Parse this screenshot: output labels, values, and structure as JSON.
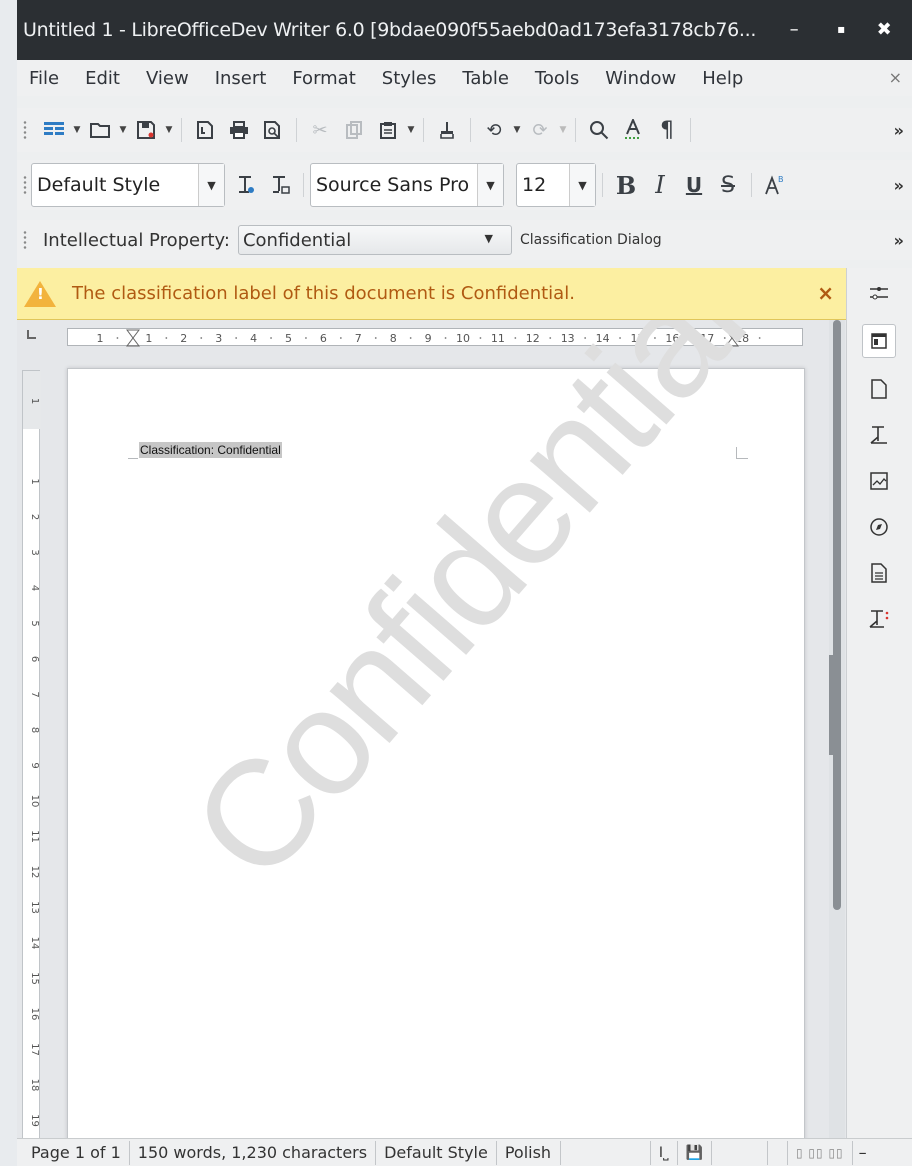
{
  "window": {
    "title": "Untitled 1 - LibreOfficeDev Writer 6.0 [9bdae090f55aebd0ad173efa3178cb76...",
    "minimize_glyph": "–",
    "maximize_glyph": "▪",
    "close_glyph": "✖"
  },
  "menu": {
    "items": [
      "File",
      "Edit",
      "View",
      "Insert",
      "Format",
      "Styles",
      "Table",
      "Tools",
      "Window",
      "Help"
    ],
    "close_glyph": "×"
  },
  "formatting": {
    "paragraph_style": "Default Style",
    "font_name": "Source Sans Pro",
    "font_size": "12",
    "bold": "B",
    "italic": "I",
    "underline": "U",
    "strike": "S"
  },
  "classification_toolbar": {
    "label": "Intellectual Property:",
    "value": "Confidential",
    "dialog_button": "Classification Dialog"
  },
  "infobar": {
    "message": "The classification label of this document is Confidential.",
    "close_glyph": "×"
  },
  "document": {
    "header_text": "Classification: Confidential",
    "watermark": "Confidential"
  },
  "ruler": {
    "horizontal_ticks": [
      "1",
      "1",
      "2",
      "3",
      "4",
      "5",
      "6",
      "7",
      "8",
      "9",
      "10",
      "11",
      "12",
      "13",
      "14",
      "15",
      "16",
      "17",
      "18"
    ],
    "vertical_ticks": [
      "1",
      "1",
      "2",
      "3",
      "4",
      "5",
      "6",
      "7",
      "8",
      "9",
      "10",
      "11",
      "12",
      "13",
      "14",
      "15",
      "16",
      "17",
      "18",
      "19"
    ]
  },
  "statusbar": {
    "page": "Page 1 of 1",
    "counts": "150 words, 1,230 characters",
    "style": "Default Style",
    "language": "Polish",
    "insert_mode": "I⎵",
    "minus": "–"
  },
  "overflow_glyph": "»",
  "icons": {
    "toolbar1": [
      "new-document-icon",
      "open-folder-icon",
      "save-icon",
      "export-pdf-icon",
      "print-icon",
      "print-preview-icon",
      "cut-icon",
      "copy-icon",
      "paste-icon",
      "clone-formatting-icon",
      "undo-icon",
      "redo-icon",
      "find-replace-icon",
      "spelling-icon",
      "formatting-marks-icon"
    ],
    "sidebar": [
      "properties-icon",
      "styles-icon",
      "page-icon",
      "style-inspector-icon",
      "gallery-icon",
      "navigator-icon",
      "manage-changes-icon",
      "design-icon"
    ]
  },
  "colors": {
    "titlebar_bg": "#2b2f33",
    "infobar_bg": "#fcefa1",
    "infobar_text": "#b05a12",
    "watermark": "#dedede"
  }
}
